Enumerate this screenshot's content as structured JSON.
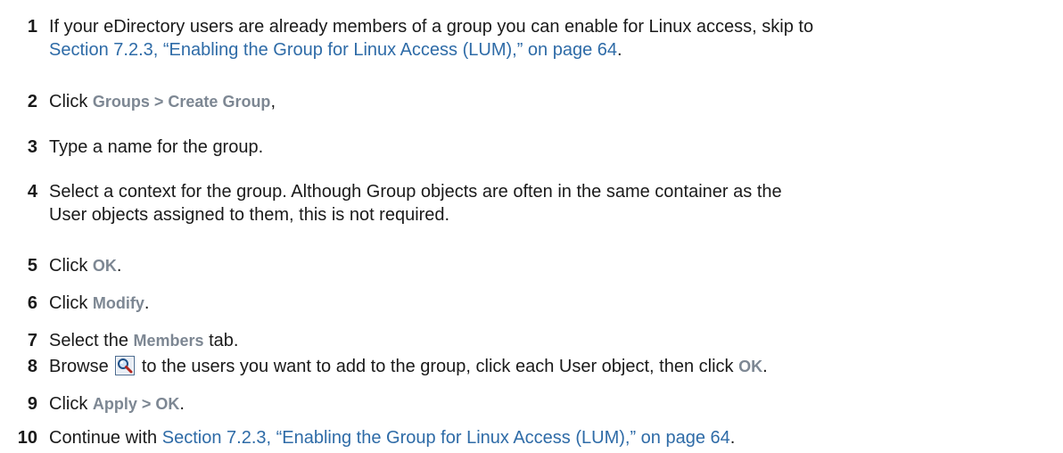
{
  "steps": [
    {
      "num": "1",
      "line1_text": "If your eDirectory users are already members of a group you can enable for Linux access, skip to",
      "line2_link": "Section 7.2.3, “Enabling the Group for Linux Access (LUM),” on page 64",
      "line2_after": "."
    },
    {
      "num": "2",
      "before": "Click ",
      "ui": "Groups > Create Group",
      "after": ","
    },
    {
      "num": "3",
      "text": "Type a name for the group."
    },
    {
      "num": "4",
      "line1_text": "Select a context for the group. Although Group objects are often in the same container as the",
      "line2_text": "User objects assigned to them, this is not required."
    },
    {
      "num": "5",
      "before": "Click ",
      "ui": "OK",
      "after": "."
    },
    {
      "num": "6",
      "before": "Click ",
      "ui": "Modify",
      "after": "."
    },
    {
      "num": "7",
      "before": "Select the ",
      "ui": "Members",
      "after": " tab."
    },
    {
      "num": "8",
      "before": "Browse",
      "icon": "browse-magnifier-icon",
      "middle": "to the users you want to add to the group, click each User object, then click ",
      "ui": "OK",
      "after": "."
    },
    {
      "num": "9",
      "before": "Click ",
      "ui": "Apply > OK",
      "after": "."
    },
    {
      "num": "10",
      "before": "Continue with ",
      "link": "Section 7.2.3, “Enabling the Group for Linux Access (LUM),” on page 64",
      "after": "."
    }
  ],
  "colors": {
    "link": "#2e6ba7",
    "ui_term": "#7d8793",
    "text": "#1a1a1a"
  }
}
